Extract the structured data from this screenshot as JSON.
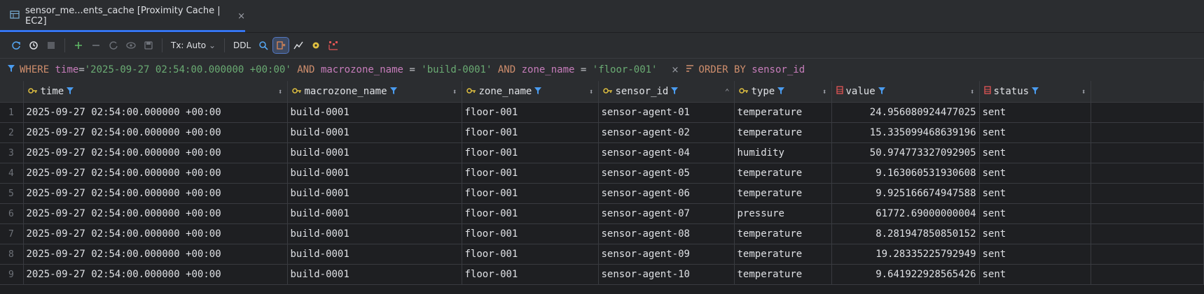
{
  "tab": {
    "title": "sensor_me...ents_cache [Proximity Cache | EC2]",
    "close": "×"
  },
  "toolbar": {
    "tx_label": "Tx: Auto",
    "ddl_label": "DDL"
  },
  "filter": {
    "where": "WHERE",
    "time_col": "time",
    "eq": "=",
    "time_val": "'2025-09-27 02:54:00.000000 +00:00'",
    "and1": "AND",
    "macro_col": "macrozone_name",
    "eq2": "=",
    "macro_val": "'build-0001'",
    "and2": "AND",
    "zone_col": "zone_name",
    "eq3": "=",
    "zone_val": "'floor-001'",
    "clear": "×",
    "order_by": "ORDER BY",
    "order_col": "sensor_id"
  },
  "columns": [
    "time",
    "macrozone_name",
    "zone_name",
    "sensor_id",
    "type",
    "value",
    "status"
  ],
  "rows": [
    [
      "1",
      "2025-09-27 02:54:00.000000 +00:00",
      "build-0001",
      "floor-001",
      "sensor-agent-01",
      "temperature",
      "24.956080924477025",
      "sent"
    ],
    [
      "2",
      "2025-09-27 02:54:00.000000 +00:00",
      "build-0001",
      "floor-001",
      "sensor-agent-02",
      "temperature",
      "15.335099468639196",
      "sent"
    ],
    [
      "3",
      "2025-09-27 02:54:00.000000 +00:00",
      "build-0001",
      "floor-001",
      "sensor-agent-04",
      "humidity",
      "50.974773327092905",
      "sent"
    ],
    [
      "4",
      "2025-09-27 02:54:00.000000 +00:00",
      "build-0001",
      "floor-001",
      "sensor-agent-05",
      "temperature",
      "9.163060531930608",
      "sent"
    ],
    [
      "5",
      "2025-09-27 02:54:00.000000 +00:00",
      "build-0001",
      "floor-001",
      "sensor-agent-06",
      "temperature",
      "9.925166674947588",
      "sent"
    ],
    [
      "6",
      "2025-09-27 02:54:00.000000 +00:00",
      "build-0001",
      "floor-001",
      "sensor-agent-07",
      "pressure",
      "61772.69000000004",
      "sent"
    ],
    [
      "7",
      "2025-09-27 02:54:00.000000 +00:00",
      "build-0001",
      "floor-001",
      "sensor-agent-08",
      "temperature",
      "8.281947850850152",
      "sent"
    ],
    [
      "8",
      "2025-09-27 02:54:00.000000 +00:00",
      "build-0001",
      "floor-001",
      "sensor-agent-09",
      "temperature",
      "19.28335225792949",
      "sent"
    ],
    [
      "9",
      "2025-09-27 02:54:00.000000 +00:00",
      "build-0001",
      "floor-001",
      "sensor-agent-10",
      "temperature",
      "9.641922928565426",
      "sent"
    ]
  ],
  "colors": {
    "accent": "#3574f0",
    "keyword": "#cf8e6d",
    "column": "#c77dbb",
    "string": "#6aab73",
    "key_icon": "#e0c040",
    "filter_icon": "#4a9cf0"
  }
}
